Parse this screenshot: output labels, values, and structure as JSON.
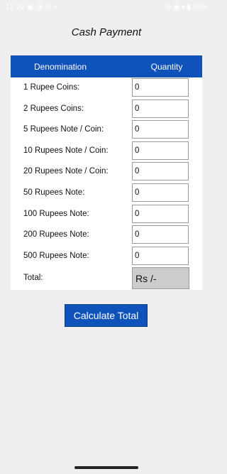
{
  "status_bar": {
    "left_text": "11:29 ▣ ◍ ◎ •",
    "right_text": "⊝ ◉ ▾ ▮ 55%"
  },
  "page": {
    "title": "Cash Payment"
  },
  "table": {
    "col_denomination": "Denomination",
    "col_quantity": "Quantity",
    "rows": [
      {
        "label": "1 Rupee Coins:",
        "quantity": "0"
      },
      {
        "label": "2 Rupees Coins:",
        "quantity": "0"
      },
      {
        "label": "5 Rupees Note / Coin:",
        "quantity": "0"
      },
      {
        "label": "10 Rupees Note / Coin:",
        "quantity": "0"
      },
      {
        "label": "20 Rupees Note / Coin:",
        "quantity": "0"
      },
      {
        "label": "50 Rupees Note:",
        "quantity": "0"
      },
      {
        "label": "100 Rupees Note:",
        "quantity": "0"
      },
      {
        "label": "200 Rupees Note:",
        "quantity": "0"
      },
      {
        "label": "500 Rupees Note:",
        "quantity": "0"
      }
    ],
    "total_label": "Total:",
    "total_value": "Rs /-"
  },
  "actions": {
    "calculate_label": "Calculate Total"
  },
  "colors": {
    "accent": "#0f52ba",
    "background": "#efeff0",
    "total_box": "#cccccc"
  }
}
